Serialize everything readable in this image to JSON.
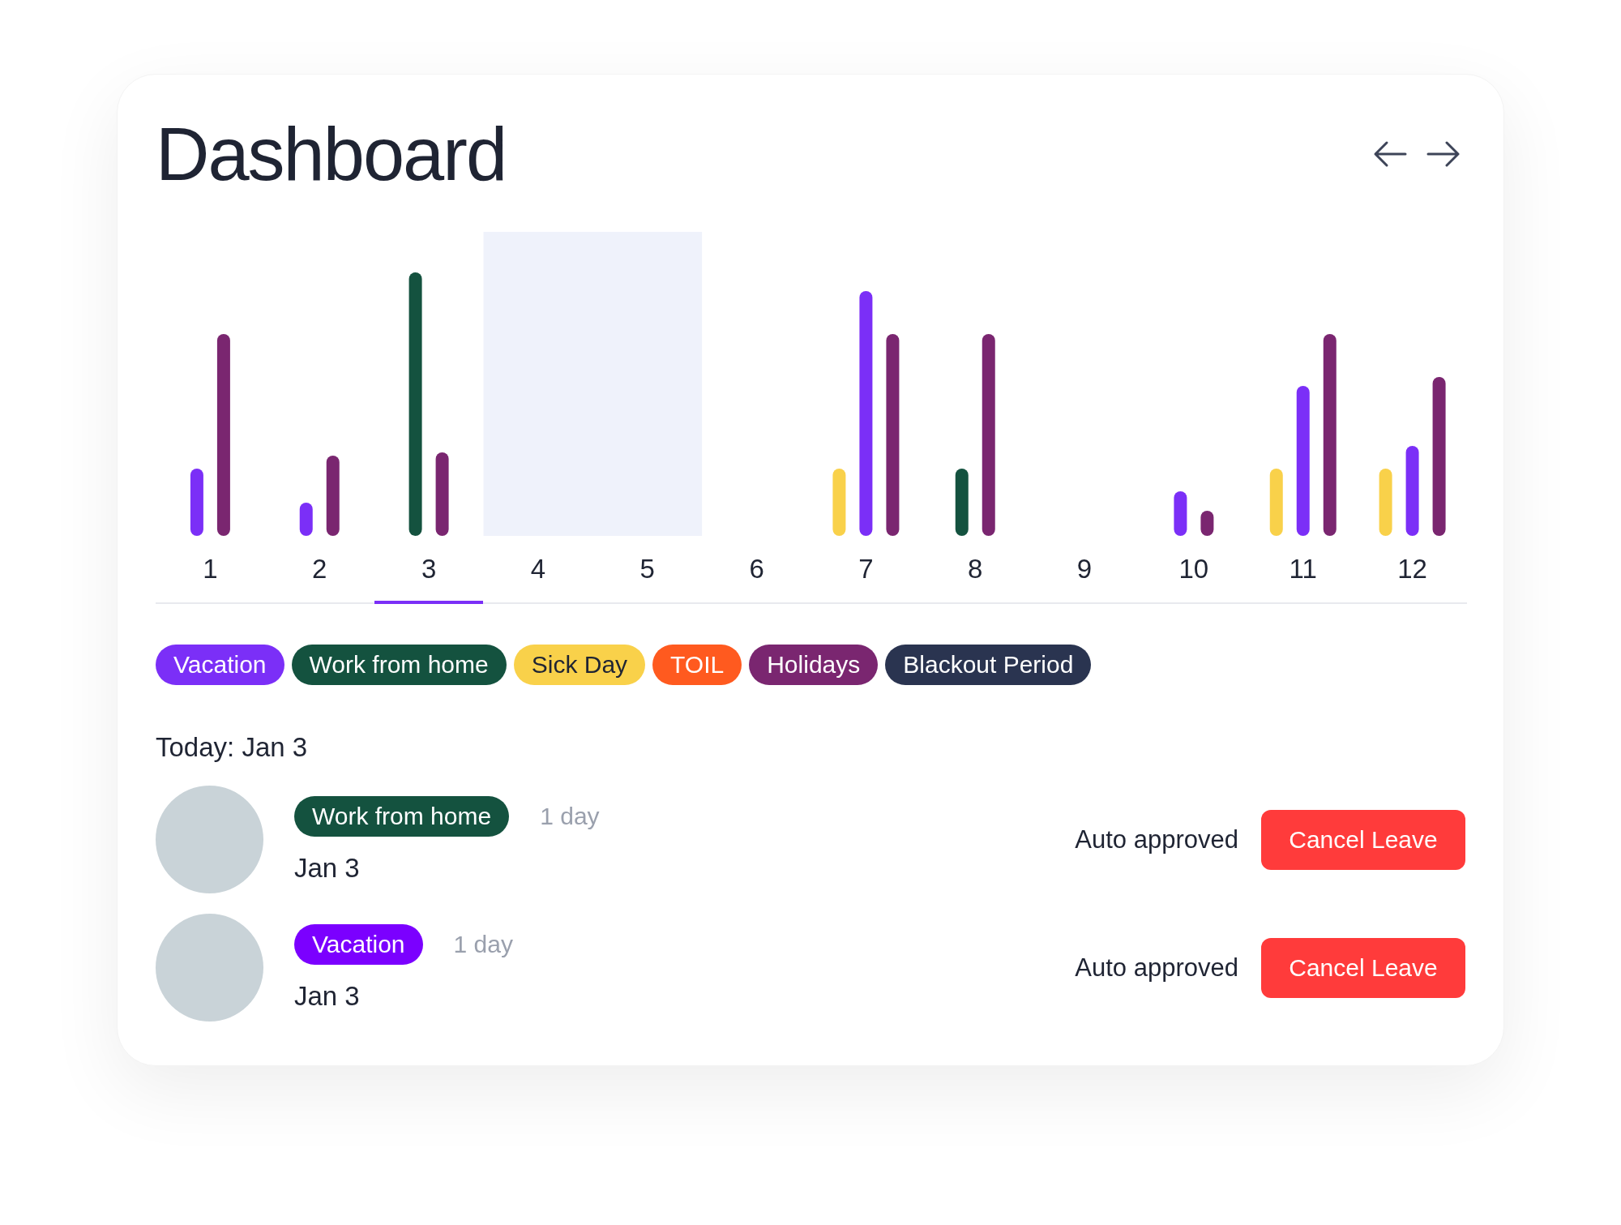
{
  "title": "Dashboard",
  "columns": [
    {
      "label": "1",
      "selected": false
    },
    {
      "label": "2",
      "selected": false
    },
    {
      "label": "3",
      "selected": true
    },
    {
      "label": "4",
      "selected": false
    },
    {
      "label": "5",
      "selected": false
    },
    {
      "label": "6",
      "selected": false
    },
    {
      "label": "7",
      "selected": false
    },
    {
      "label": "8",
      "selected": false
    },
    {
      "label": "9",
      "selected": false
    },
    {
      "label": "10",
      "selected": false
    },
    {
      "label": "11",
      "selected": false
    },
    {
      "label": "12",
      "selected": false
    }
  ],
  "legend": [
    {
      "label": "Vacation",
      "color": "#7b2ff7"
    },
    {
      "label": "Work from home",
      "color": "#14523f"
    },
    {
      "label": "Sick Day",
      "color": "#f9d14a"
    },
    {
      "label": "TOIL",
      "color": "#ff5a1f"
    },
    {
      "label": "Holidays",
      "color": "#7a2670"
    },
    {
      "label": "Blackout Period",
      "color": "#2a3450"
    }
  ],
  "today": "Today: Jan 3",
  "leaves": [
    {
      "type": "Work from home",
      "color": "#14523f",
      "duration": "1 day",
      "date": "Jan 3",
      "status": "Auto approved",
      "action": "Cancel Leave"
    },
    {
      "type": "Vacation",
      "color": "#7b00ff",
      "duration": "1 day",
      "date": "Jan 3",
      "status": "Auto approved",
      "action": "Cancel Leave"
    }
  ]
}
